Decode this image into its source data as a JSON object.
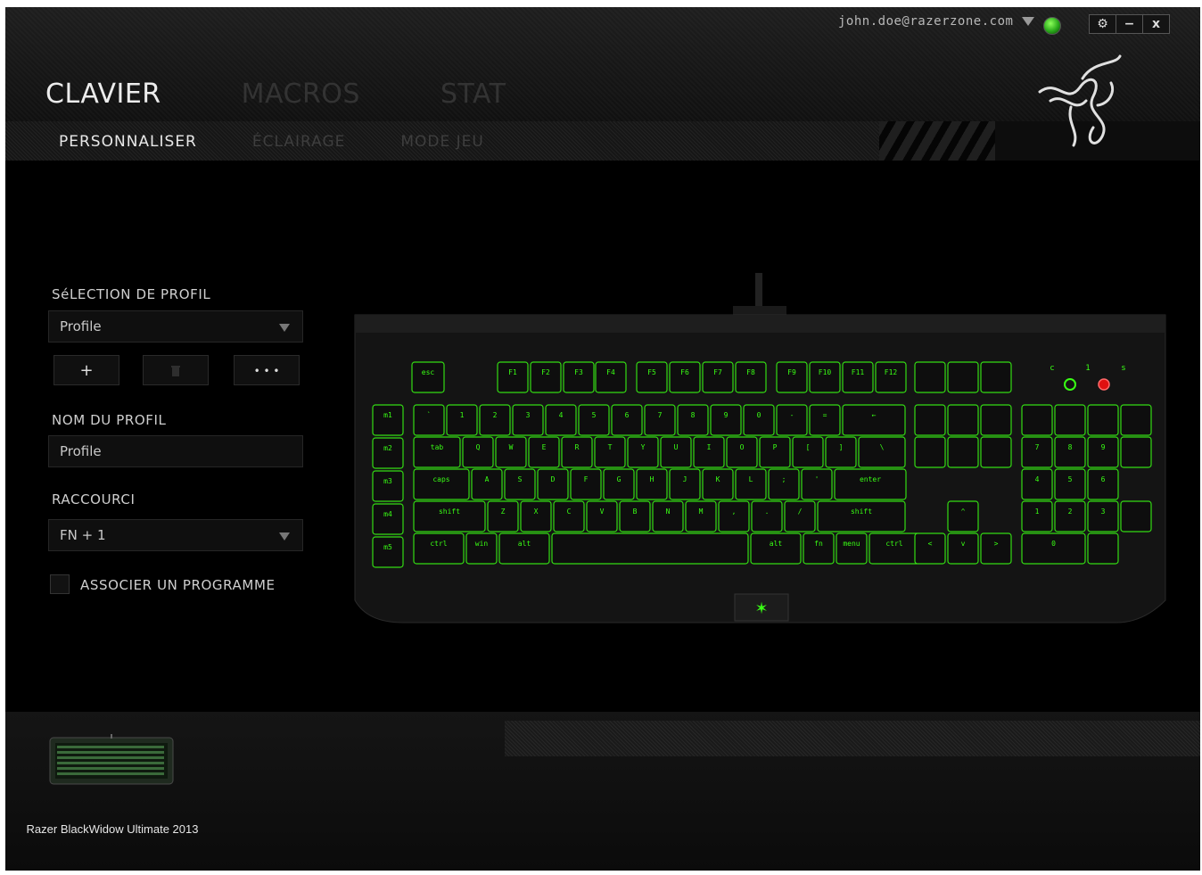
{
  "header": {
    "account_email": "john.doe@razerzone.com",
    "window_buttons": [
      "⚙",
      "−",
      "x"
    ],
    "top_tabs": [
      {
        "label": "CLAVIER",
        "active": true
      },
      {
        "label": "MACROS",
        "active": false
      },
      {
        "label": "STAT",
        "active": false
      }
    ],
    "sub_tabs": [
      {
        "label": "PERSONNALISER",
        "active": true
      },
      {
        "label": "ÉCLAIRAGE",
        "active": false
      },
      {
        "label": "MODE JEU",
        "active": false
      }
    ]
  },
  "profile_panel": {
    "profile_selection_label": "SéLECTION DE PROFIL",
    "profile_dropdown_value": "Profile",
    "add_button": "+",
    "delete_icon": "trash-icon",
    "more_button": "• • •",
    "profile_name_label": "NOM DU PROFIL",
    "profile_name_value": "Profile",
    "shortcut_label": "RACCOURCI",
    "shortcut_value": "FN + 1",
    "link_program_label": "ASSOCIER UN PROGRAMME",
    "link_program_checked": false
  },
  "keyboard": {
    "macro_keys": [
      "m1",
      "m2",
      "m3",
      "m4",
      "m5"
    ],
    "function_row": [
      "esc",
      "F1",
      "F2",
      "F3",
      "F4",
      "F5",
      "F6",
      "F7",
      "F8",
      "F9",
      "F10",
      "F11",
      "F12"
    ],
    "number_row": [
      "`",
      "1",
      "2",
      "3",
      "4",
      "5",
      "6",
      "7",
      "8",
      "9",
      "0",
      "-",
      "=",
      "←"
    ],
    "top_row": [
      "tab",
      "Q",
      "W",
      "E",
      "R",
      "T",
      "Y",
      "U",
      "I",
      "O",
      "P",
      "[",
      "]",
      "\\"
    ],
    "home_row": [
      "caps",
      "A",
      "S",
      "D",
      "F",
      "G",
      "H",
      "J",
      "K",
      "L",
      ";",
      "'",
      "enter"
    ],
    "bottom_row": [
      "shift",
      "Z",
      "X",
      "C",
      "V",
      "B",
      "N",
      "M",
      ",",
      ".",
      "/",
      "shift"
    ],
    "space_row": [
      "ctrl",
      "win",
      "alt",
      "",
      "alt",
      "fn",
      "menu",
      "ctrl"
    ],
    "arrows": [
      "^",
      "<",
      "v",
      ">"
    ],
    "numpad": [
      "7",
      "8",
      "9",
      "4",
      "5",
      "6",
      "1",
      "2",
      "3",
      "0"
    ],
    "indicators": [
      "c",
      "1",
      "s"
    ],
    "glow_color": "#39ff14"
  },
  "device": {
    "name": "Razer BlackWidow Ultimate 2013"
  }
}
